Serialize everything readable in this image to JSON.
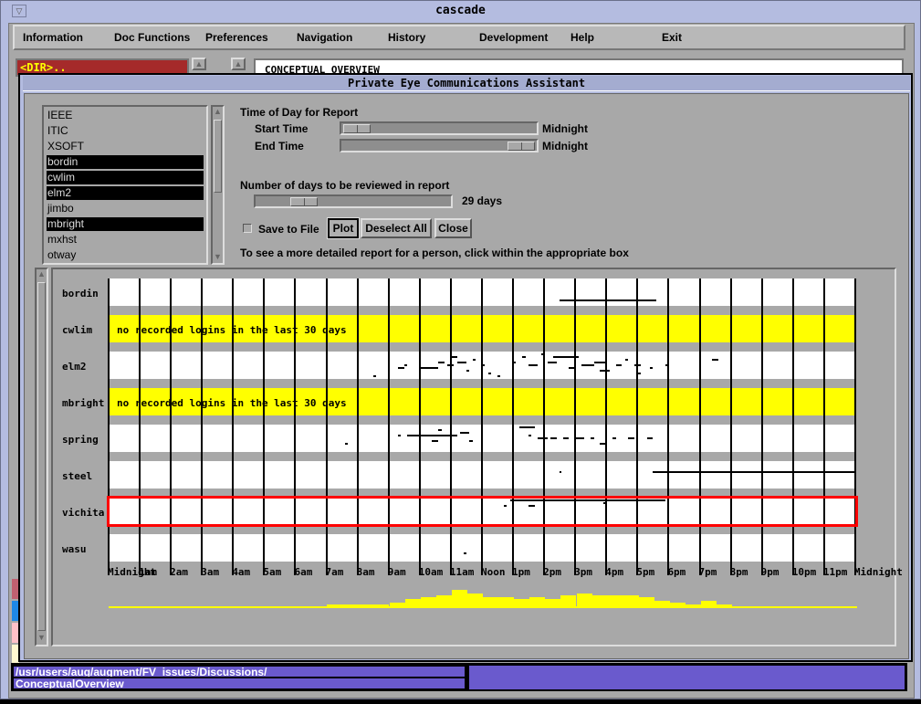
{
  "window": {
    "title": "cascade"
  },
  "menu": [
    "Information",
    "Doc Functions",
    "Preferences",
    "Navigation",
    "History",
    "Development",
    "Help",
    "Exit"
  ],
  "background": {
    "dir_item": "<DIR>..",
    "doc_title": "CONCEPTUAL OVERVIEW"
  },
  "dialog": {
    "title": "Private Eye Communications Assistant",
    "users": [
      {
        "name": "IEEE",
        "selected": false
      },
      {
        "name": "ITIC",
        "selected": false
      },
      {
        "name": "XSOFT",
        "selected": false
      },
      {
        "name": "bordin",
        "selected": true
      },
      {
        "name": "cwlim",
        "selected": true
      },
      {
        "name": "elm2",
        "selected": true
      },
      {
        "name": "jimbo",
        "selected": false
      },
      {
        "name": "mbright",
        "selected": true
      },
      {
        "name": "mxhst",
        "selected": false
      },
      {
        "name": "otway",
        "selected": false
      }
    ],
    "time_heading": "Time of Day for Report",
    "start_label": "Start Time",
    "start_value": "Midnight",
    "start_fraction": 0.0,
    "end_label": "End Time",
    "end_value": "Midnight",
    "end_fraction": 1.0,
    "days_heading": "Number of days to be reviewed in report",
    "days_value": "29 days",
    "days_fraction": 0.2,
    "save_label": "Save to File",
    "save_checked": false,
    "plot_label": "Plot",
    "deselect_label": "Deselect All",
    "close_label": "Close",
    "hint": "To see a more detailed report for a person, click within the appropriate box"
  },
  "chart_data": {
    "type": "scatter",
    "x_unit": "hour of day",
    "xlim": [
      0,
      24
    ],
    "x_ticks": [
      "Midnight",
      "1am",
      "2am",
      "3am",
      "4am",
      "5am",
      "6am",
      "7am",
      "8am",
      "9am",
      "10am",
      "11am",
      "Noon",
      "1pm",
      "2pm",
      "3pm",
      "4pm",
      "5pm",
      "6pm",
      "7pm",
      "8pm",
      "9pm",
      "10pm",
      "11pm",
      "Midnight"
    ],
    "no_login_text": "no recorded logins in the last 30 days",
    "highlighted_row": "vichita",
    "highlight_color": "#ff0000",
    "no_login_color": "#ffff00",
    "rows": [
      {
        "user": "bordin",
        "none": false,
        "sessions": [
          [
            14.5,
            17.6,
            7
          ]
        ]
      },
      {
        "user": "cwlim",
        "none": true,
        "sessions": []
      },
      {
        "user": "elm2",
        "none": false,
        "sessions": [
          [
            8.5,
            8.6,
            8
          ],
          [
            9.3,
            9.5,
            5
          ],
          [
            9.5,
            9.6,
            4
          ],
          [
            10.0,
            10.3,
            5
          ],
          [
            10.3,
            10.6,
            5
          ],
          [
            10.6,
            10.8,
            3
          ],
          [
            10.9,
            11.1,
            4
          ],
          [
            11.0,
            11.2,
            1
          ],
          [
            11.2,
            11.5,
            3
          ],
          [
            11.5,
            11.6,
            6
          ],
          [
            11.7,
            11.8,
            2
          ],
          [
            12.0,
            12.1,
            4
          ],
          [
            12.2,
            12.3,
            7
          ],
          [
            12.5,
            12.6,
            8
          ],
          [
            13.0,
            13.1,
            3
          ],
          [
            13.3,
            13.4,
            1
          ],
          [
            13.5,
            13.8,
            4
          ],
          [
            13.9,
            14.0,
            0
          ],
          [
            14.1,
            14.4,
            3
          ],
          [
            14.3,
            15.1,
            1
          ],
          [
            14.8,
            15.0,
            5
          ],
          [
            15.2,
            15.6,
            4
          ],
          [
            15.6,
            16.0,
            3
          ],
          [
            15.8,
            16.1,
            6
          ],
          [
            16.3,
            16.5,
            4
          ],
          [
            16.6,
            16.7,
            2
          ],
          [
            16.9,
            17.1,
            4
          ],
          [
            17.0,
            17.1,
            7
          ],
          [
            17.4,
            17.5,
            5
          ],
          [
            17.9,
            18.0,
            4
          ],
          [
            19.4,
            19.6,
            2
          ]
        ]
      },
      {
        "user": "mbright",
        "none": true,
        "sessions": []
      },
      {
        "user": "spring",
        "none": false,
        "sessions": [
          [
            7.6,
            7.7,
            6
          ],
          [
            9.3,
            9.4,
            3
          ],
          [
            9.6,
            11.2,
            3
          ],
          [
            10.4,
            10.6,
            5
          ],
          [
            10.6,
            10.7,
            1
          ],
          [
            11.3,
            11.6,
            2
          ],
          [
            11.6,
            11.7,
            5
          ],
          [
            13.2,
            13.7,
            0
          ],
          [
            13.5,
            13.6,
            3
          ],
          [
            13.8,
            14.1,
            4
          ],
          [
            14.2,
            14.4,
            4
          ],
          [
            14.6,
            14.8,
            4
          ],
          [
            15.0,
            15.3,
            4
          ],
          [
            15.5,
            15.6,
            4
          ],
          [
            15.8,
            16.0,
            6
          ],
          [
            16.2,
            16.3,
            4
          ],
          [
            16.7,
            16.9,
            4
          ],
          [
            17.3,
            17.5,
            4
          ]
        ]
      },
      {
        "user": "steel",
        "none": false,
        "sessions": [
          [
            14.5,
            14.55,
            3
          ],
          [
            17.5,
            17.6,
            3
          ],
          [
            17.6,
            24.0,
            3
          ]
        ]
      },
      {
        "user": "vichita",
        "none": false,
        "sessions": [
          [
            12.7,
            12.8,
            2
          ],
          [
            13.5,
            13.7,
            2
          ],
          [
            12.9,
            17.9,
            0
          ],
          [
            15.9,
            16.0,
            1
          ]
        ]
      },
      {
        "user": "wasu",
        "none": false,
        "sessions": [
          [
            11.4,
            11.5,
            6
          ]
        ]
      }
    ],
    "activity_histogram": [
      0,
      0,
      0,
      0,
      0,
      0,
      0,
      0,
      0,
      0,
      0,
      0,
      0,
      0,
      0.1,
      0.1,
      0.1,
      0.1,
      0.2,
      0.4,
      0.5,
      0.6,
      0.9,
      0.7,
      0.5,
      0.5,
      0.4,
      0.5,
      0.4,
      0.6,
      0.7,
      0.6,
      0.6,
      0.6,
      0.5,
      0.3,
      0.2,
      0.1,
      0.3,
      0.1,
      0,
      0,
      0,
      0,
      0,
      0,
      0,
      0
    ]
  },
  "status": {
    "path": "/usr/users/aug/augment/FV_issues/Discussions/",
    "node": "ConceptualOverview"
  },
  "colors": {
    "status_bar": "#6a5acd",
    "histogram": "#ffff00"
  }
}
